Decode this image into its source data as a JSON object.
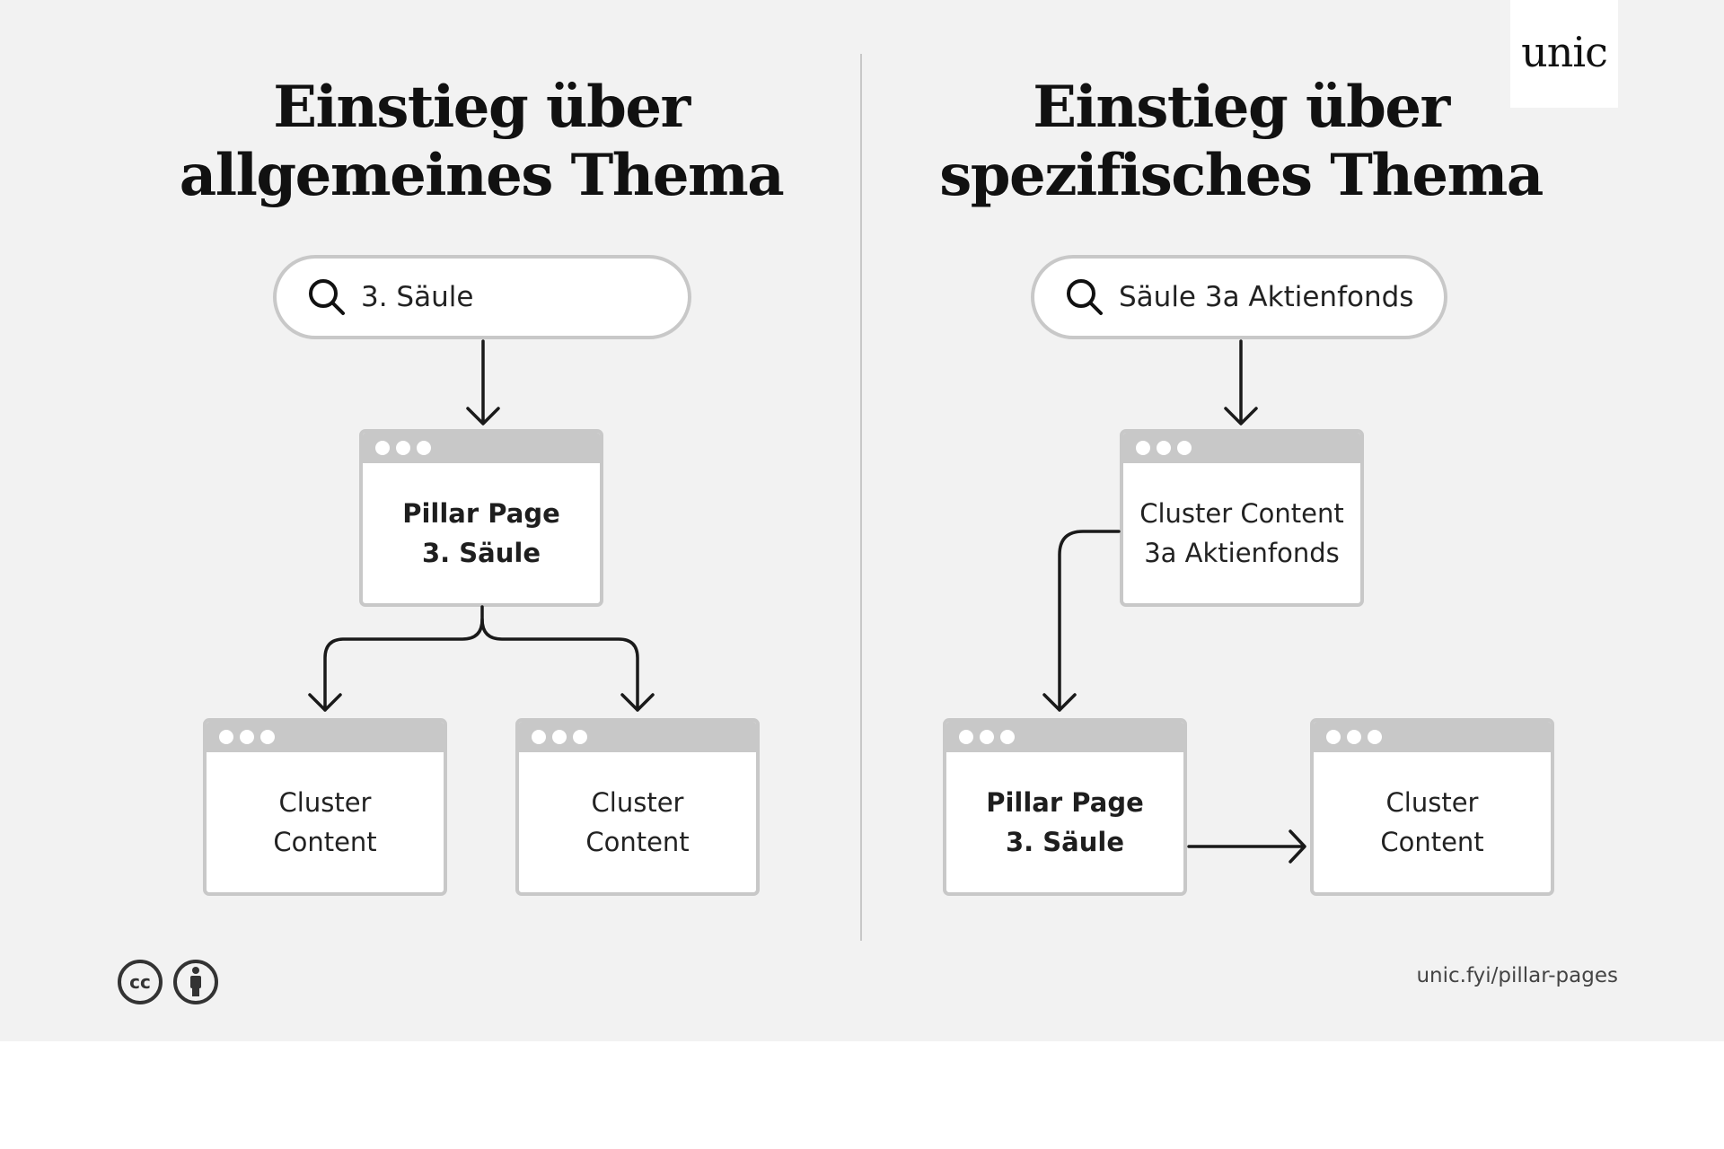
{
  "logo": {
    "text": "unic"
  },
  "left": {
    "title_lines": [
      "Einstieg über",
      "allgemeines Thema"
    ],
    "search": {
      "icon": "search-icon",
      "query": "3. Säule"
    },
    "pillar": {
      "lines": [
        "Pillar Page",
        "3. Säule"
      ],
      "bold": true
    },
    "clusters": [
      {
        "lines": [
          "Cluster",
          "Content"
        ]
      },
      {
        "lines": [
          "Cluster",
          "Content"
        ]
      }
    ]
  },
  "right": {
    "title_lines": [
      "Einstieg über",
      "spezifisches Thema"
    ],
    "search": {
      "icon": "search-icon",
      "query": "Säule 3a Aktienfonds"
    },
    "entry_cluster": {
      "lines": [
        "Cluster Content",
        "3a Aktienfonds"
      ]
    },
    "pillar": {
      "lines": [
        "Pillar Page",
        "3. Säule"
      ],
      "bold": true
    },
    "cluster": {
      "lines": [
        "Cluster",
        "Content"
      ]
    }
  },
  "footer": {
    "license_icons": [
      "creative-commons-icon",
      "attribution-icon"
    ],
    "url": "unic.fyi/pillar-pages"
  },
  "colors": {
    "background": "#f2f2f2",
    "border": "#c8c8c8",
    "text": "#1e1e1e",
    "card": "#ffffff"
  }
}
